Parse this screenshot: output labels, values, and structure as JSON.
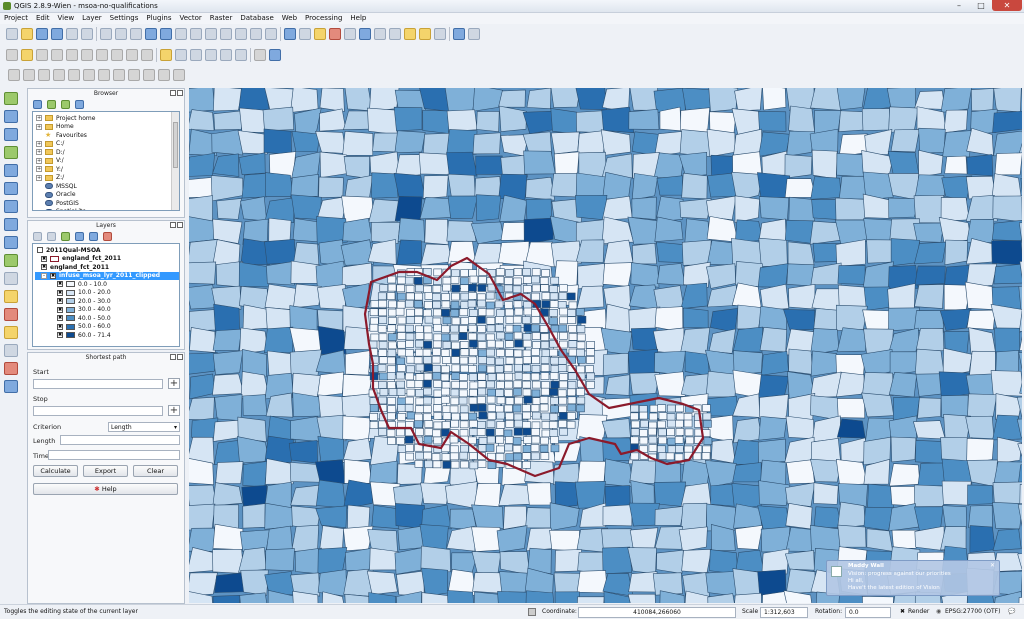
{
  "window": {
    "title": "QGIS 2.8.9-Wien - msoa-no-qualifications",
    "minimize": "–",
    "maximize": "□",
    "close": "✕"
  },
  "menu": [
    "Project",
    "Edit",
    "View",
    "Layer",
    "Settings",
    "Plugins",
    "Vector",
    "Raster",
    "Database",
    "Web",
    "Processing",
    "Help"
  ],
  "browser": {
    "title": "Browser",
    "items": [
      {
        "label": "Project home",
        "icon": "folder-icon",
        "expandable": true
      },
      {
        "label": "Home",
        "icon": "folder-icon",
        "expandable": true
      },
      {
        "label": "Favourites",
        "icon": "star-icon",
        "expandable": false
      },
      {
        "label": "C:/",
        "icon": "folder-icon",
        "expandable": true
      },
      {
        "label": "D:/",
        "icon": "folder-icon",
        "expandable": true
      },
      {
        "label": "V:/",
        "icon": "folder-icon",
        "expandable": true
      },
      {
        "label": "Y:/",
        "icon": "folder-icon",
        "expandable": true
      },
      {
        "label": "Z:/",
        "icon": "folder-icon",
        "expandable": true
      },
      {
        "label": "MSSQL",
        "icon": "database-icon",
        "expandable": false
      },
      {
        "label": "Oracle",
        "icon": "database-icon",
        "expandable": false
      },
      {
        "label": "PostGIS",
        "icon": "database-icon",
        "expandable": false
      },
      {
        "label": "SpatiaLite",
        "icon": "database-icon",
        "expandable": false
      }
    ]
  },
  "layers": {
    "title": "Layers",
    "items": [
      {
        "label": "2011Qual-MSOA",
        "checked": false,
        "bold": true
      },
      {
        "label": "england_fct_2011",
        "checked": true,
        "bold": true,
        "swatch": "#ffffff",
        "border": "#8b1a2b"
      },
      {
        "label": "england_fct_2011",
        "checked": true,
        "bold": true
      },
      {
        "label": "infuse_msoa_lyr_2011_clipped",
        "checked": true,
        "bold": true,
        "selected": true
      }
    ],
    "legend": [
      {
        "label": "0.0 - 10.0",
        "color": "#f4f8fd"
      },
      {
        "label": "10.0 - 20.0",
        "color": "#d6e5f4"
      },
      {
        "label": "20.0 - 30.0",
        "color": "#b2cfe8"
      },
      {
        "label": "30.0 - 40.0",
        "color": "#7fb0d8"
      },
      {
        "label": "40.0 - 50.0",
        "color": "#4c8ec4"
      },
      {
        "label": "50.0 - 60.0",
        "color": "#2a6fb0"
      },
      {
        "label": "60.0 - 71.4",
        "color": "#0d4a8f"
      }
    ]
  },
  "shortest_path": {
    "title": "Shortest path",
    "start_label": "Start",
    "stop_label": "Stop",
    "criterion_label": "Criterion",
    "criterion_value": "Length",
    "length_label": "Length",
    "time_label": "Time",
    "calculate": "Calculate",
    "export": "Export",
    "clear": "Clear",
    "help": "Help"
  },
  "status": {
    "message": "Toggles the editing state of the current layer",
    "coordinate_label": "Coordinate:",
    "coordinate": "410084,266060",
    "scale_label": "Scale",
    "scale": "1:312,603",
    "rotation_label": "Rotation:",
    "rotation": "0.0",
    "render_label": "Render",
    "crs": "EPSG:27700 (OTF)"
  },
  "notification": {
    "name": "Maddy Wall",
    "line1": "Vision: progress against our priorities",
    "line2": "Hi all,",
    "line3": "Have't the latest edition of Vision"
  },
  "map": {
    "boundary_color": "#8b1a2b",
    "background": "#5d93c3"
  }
}
